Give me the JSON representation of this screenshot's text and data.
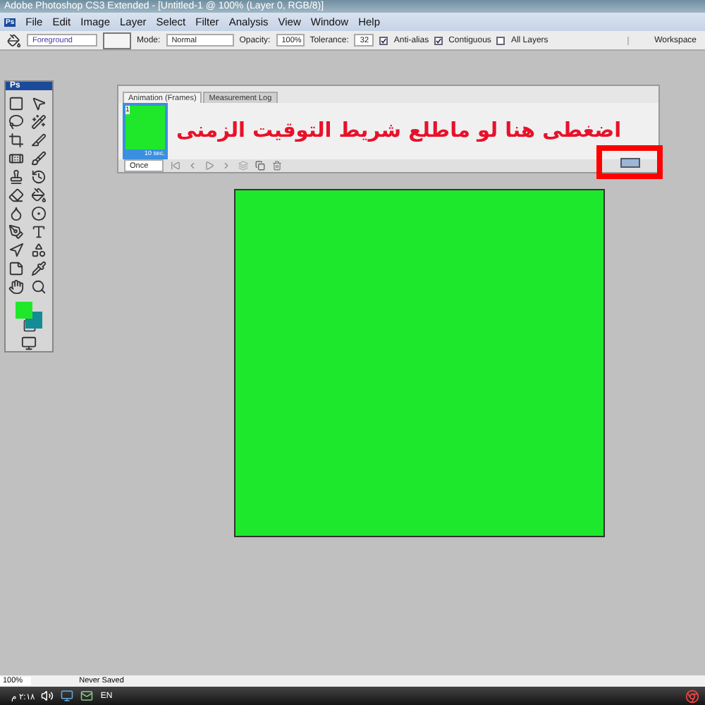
{
  "window": {
    "title": "Adobe Photoshop CS3 Extended - [Untitled-1 @ 100% (Layer 0, RGB/8)]"
  },
  "menu": [
    "File",
    "Edit",
    "Image",
    "Layer",
    "Select",
    "Filter",
    "Analysis",
    "View",
    "Window",
    "Help"
  ],
  "options_bar": {
    "fill_source": "Foreground",
    "mode_label": "Mode:",
    "mode": "Normal",
    "opacity_label": "Opacity:",
    "opacity": "100%",
    "tolerance_label": "Tolerance:",
    "tolerance": "32",
    "checkboxes": [
      {
        "label": "Anti-alias",
        "checked": true
      },
      {
        "label": "Contiguous",
        "checked": true
      },
      {
        "label": "All Layers",
        "checked": false
      }
    ],
    "workspace": "Workspace"
  },
  "toolbox": {
    "logo": "Ps"
  },
  "animation_panel": {
    "tabs": [
      {
        "label": "Animation (Frames)",
        "selected": true
      },
      {
        "label": "Measurement Log",
        "selected": false
      }
    ],
    "frames": [
      {
        "number": "1",
        "delay": "10 sec.",
        "selected": true
      }
    ],
    "loop": "Once",
    "annotation": "اضغطى هنا لو ماطلع شريط التوقيت الزمنى"
  },
  "status_bar": {
    "zoom": "100%",
    "info": "Never Saved"
  },
  "menu_bar": {
    "logo": "Ps"
  },
  "taskbar": {
    "clock": "٢:١٨ م",
    "language": "EN"
  }
}
